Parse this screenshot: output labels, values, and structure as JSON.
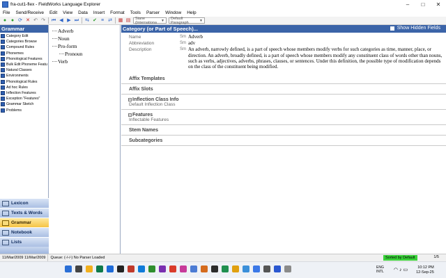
{
  "window": {
    "title": "fra-cut1-flex - FieldWorks Language Explorer",
    "controls": [
      "–",
      "□",
      "✕"
    ]
  },
  "menu": [
    "File",
    "Send/Receive",
    "Edit",
    "View",
    "Data",
    "Insert",
    "Format",
    "Tools",
    "Parser",
    "Window",
    "Help"
  ],
  "toolbar": {
    "writing_system_select": "Siane (Internationa",
    "style_select": "Default Paragraph"
  },
  "sidebar": {
    "title": "Grammar",
    "tools": [
      "Category Edit",
      "Categories Browse",
      "Compound Rules",
      "Phonemes",
      "Phonological Features",
      "Bulk Edit Phoneme Featu",
      "Natural Classes",
      "Environments",
      "Phonological Rules",
      "Ad hoc Rules",
      "Inflection Features",
      "Exception \"Features\"",
      "Grammar Sketch",
      "Problems"
    ],
    "areas": [
      "Lexicon",
      "Texts & Words",
      "Grammar",
      "Notebook",
      "Lists"
    ]
  },
  "tree": {
    "items": [
      "Adverb",
      "Noun",
      "Pro-form",
      "Pronoun",
      "Verb"
    ]
  },
  "main": {
    "header_title": "Category (or Part of Speech)...",
    "show_hidden_label": "Show Hidden Fields",
    "fields": {
      "name_label": "Name",
      "name_ws": "Sm",
      "name_value": "Adverb",
      "abbr_label": "Abbreviation",
      "abbr_ws": "Sm",
      "abbr_value": "adv",
      "desc_label": "Description",
      "desc_ws": "Sm",
      "desc_value": "An adverb, narrowly defined, is a part of speech whose members modify verbs for such categories as time, manner, place, or direction. An adverb, broadly defined, is a part of speech whose members modify any constituent class of words other than nouns, such as verbs, adjectives, adverbs, phrases, clauses, or sentences. Under this definition, the possible type of modification depends on the class of the constituent being modified."
    },
    "sections": {
      "affix_templates": "Affix Templates",
      "affix_slots": "Affix Slots",
      "inflection_class_info": "Inflection Class Info",
      "default_inflection_class": "Default Inflection Class",
      "features": "Features",
      "inflectable_features": "Inflectable Features",
      "stem_names": "Stem Names",
      "subcategories": "Subcategories"
    }
  },
  "status": {
    "dates": "11/Mar/2009 11/Mar/2009",
    "parser": "Queue: (-/-/-) No Parser Loaded",
    "sorted": "Sorted by Default",
    "page": "1/5"
  },
  "taskbar": {
    "lang_top": "ENG",
    "lang_bottom": "INTL",
    "time": "10:12 PM",
    "date": "12-Sep-25",
    "colors": [
      "#2b6fd6",
      "#444444",
      "#f2b01e",
      "#0e7a4a",
      "#1e6bd8",
      "#222222",
      "#c0392b",
      "#0f7bd9",
      "#2f8f2f",
      "#7a2fb0",
      "#d93b2b",
      "#c73a9a",
      "#4b7bd4",
      "#d46b1e",
      "#2b2b2b",
      "#1f8f4f",
      "#e0a010",
      "#3b8fd9",
      "#3b78e7",
      "#555555",
      "#2a57d0",
      "#8a8a8a"
    ]
  }
}
